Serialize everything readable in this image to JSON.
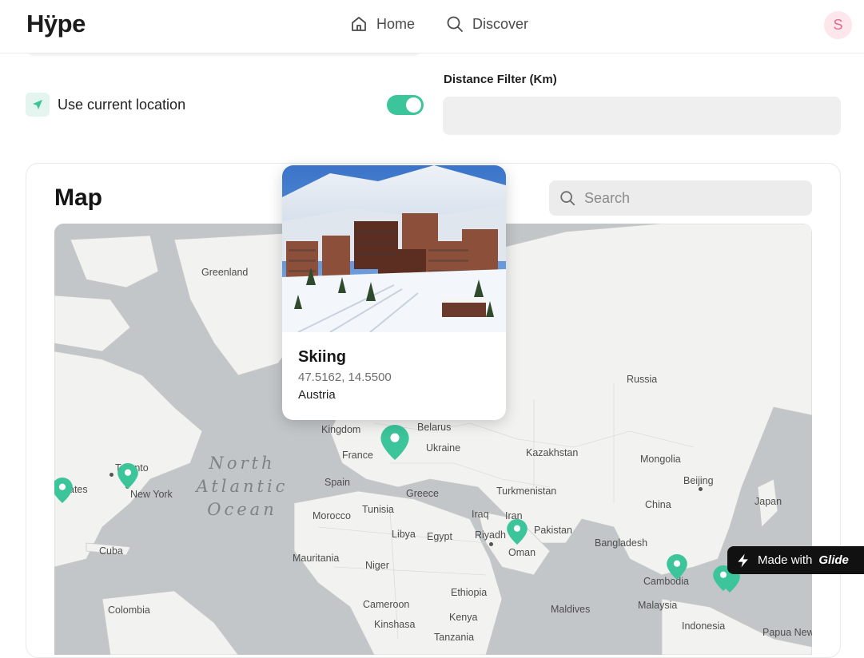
{
  "header": {
    "logo": "Hÿpe",
    "nav": [
      {
        "label": "Home",
        "icon": "home-icon"
      },
      {
        "label": "Discover",
        "icon": "search-icon"
      }
    ],
    "avatar_initial": "S"
  },
  "location": {
    "label": "Use current location",
    "toggle_on": true,
    "accent": "#3cc49a"
  },
  "distance_filter": {
    "label": "Distance Filter (Km)",
    "value": ""
  },
  "map_section": {
    "title": "Map",
    "search_placeholder": "Search",
    "country_labels": [
      "Greenland",
      "Russia",
      "Belarus",
      "Ukraine",
      "Kazakhstan",
      "Mongolia",
      "Beijing",
      "Japan",
      "China",
      "Turkmenistan",
      "France",
      "Spain",
      "Greece",
      "Tunisia",
      "Morocco",
      "Iraq",
      "Iran",
      "Riyadh",
      "Pakistan",
      "Libya",
      "Egypt",
      "Oman",
      "Bangladesh",
      "Mauritania",
      "Niger",
      "Cambodia",
      "Cuba",
      "Ethiopia",
      "Maldives",
      "Malaysia",
      "Colombia",
      "Cameroon",
      "Kenya",
      "Kinshasa",
      "Tanzania",
      "Indonesia",
      "Papua New",
      "Toronto",
      "New York",
      "ates",
      "Kingdom"
    ],
    "ocean_label": [
      "North",
      "Atlantic",
      "Ocean"
    ],
    "pin_color": "#3cc49a"
  },
  "popup": {
    "title": "Skiing",
    "coords": "47.5162, 14.5500",
    "country": "Austria"
  },
  "badge": {
    "prefix": "Made with",
    "brand": "Glide"
  }
}
